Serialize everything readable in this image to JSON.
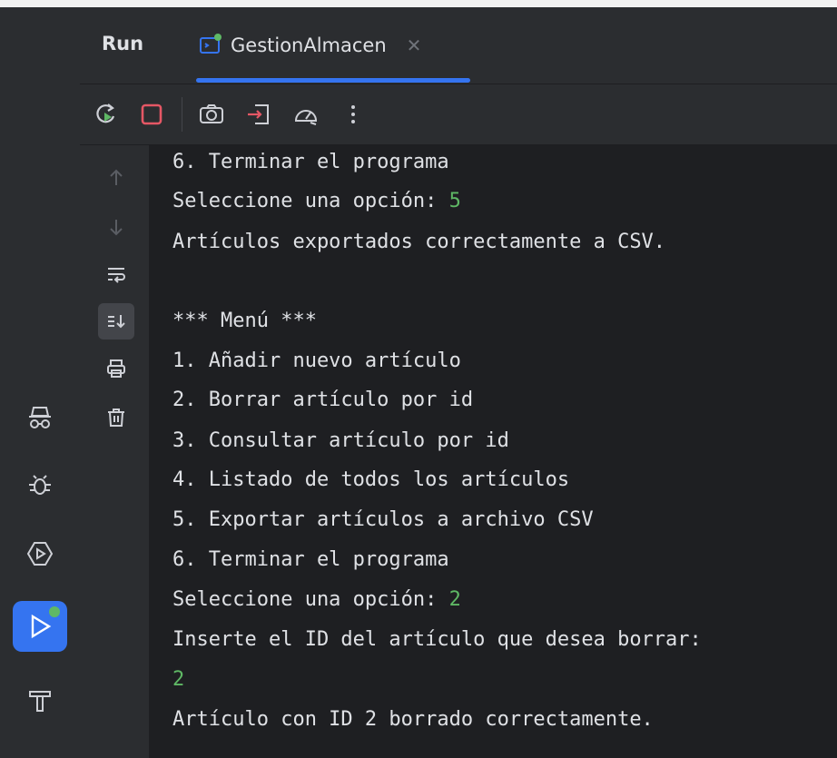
{
  "tabs": {
    "run_label": "Run",
    "active_tab_label": "GestionAlmacen"
  },
  "toolbar": {
    "buttons": [
      "rerun-icon",
      "stop-icon",
      "camera-icon",
      "exit-icon",
      "profiler-icon",
      "more-icon"
    ]
  },
  "gutter": {
    "icons": [
      "arrow-up-icon",
      "arrow-down-icon",
      "soft-wrap-icon",
      "scroll-to-end-icon",
      "print-icon",
      "trash-icon"
    ]
  },
  "left_toolbar": {
    "icons": [
      "incognito-icon",
      "bug-icon",
      "services-icon",
      "run-icon",
      "build-hammer-icon"
    ]
  },
  "console": {
    "lines": [
      {
        "text": "6. Terminar el programa"
      },
      {
        "text": "Seleccione una opción: ",
        "input": "5"
      },
      {
        "text": "Artículos exportados correctamente a CSV."
      },
      {
        "text": ""
      },
      {
        "text": "*** Menú ***"
      },
      {
        "text": "1. Añadir nuevo artículo"
      },
      {
        "text": "2. Borrar artículo por id"
      },
      {
        "text": "3. Consultar artículo por id"
      },
      {
        "text": "4. Listado de todos los artículos"
      },
      {
        "text": "5. Exportar artículos a archivo CSV"
      },
      {
        "text": "6. Terminar el programa"
      },
      {
        "text": "Seleccione una opción: ",
        "input": "2"
      },
      {
        "text": "Inserte el ID del artículo que desea borrar:"
      },
      {
        "text": "",
        "input": "2"
      },
      {
        "text": "Artículo con ID 2 borrado correctamente."
      }
    ]
  },
  "colors": {
    "accent": "#3574f0",
    "user_input": "#5fb865",
    "stop": "#e55765",
    "console_bg": "#1e1f22",
    "panel_bg": "#2b2d30"
  }
}
